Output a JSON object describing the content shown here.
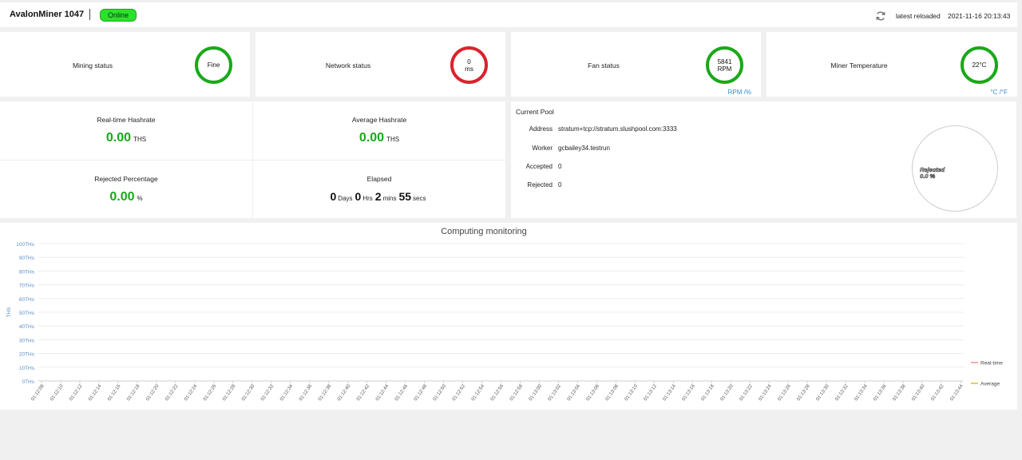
{
  "header": {
    "title": "AvalonMiner 1047",
    "status": "Online",
    "reload_label": "latest reloaded",
    "reload_time": "2021-11-16 20:13:43"
  },
  "status_cards": {
    "mining": {
      "label": "Mining status",
      "value": "Fine"
    },
    "network": {
      "label": "Network status",
      "value": "0",
      "unit": "ms"
    },
    "fan": {
      "label": "Fan status",
      "value": "5841",
      "unit": "RPM",
      "toggle": "RPM /%"
    },
    "temperature": {
      "label": "Miner Temperature",
      "value": "22°C",
      "toggle": "°C /°F"
    }
  },
  "hashrate": {
    "realtime": {
      "label": "Real-time Hashrate",
      "value": "0.00",
      "unit": "THS"
    },
    "average": {
      "label": "Average Hashrate",
      "value": "0.00",
      "unit": "THS"
    },
    "rejected": {
      "label": "Rejected Percentage",
      "value": "0.00",
      "unit": "%"
    },
    "elapsed": {
      "label": "Elapsed",
      "days": "0",
      "days_unit": "Days",
      "hrs": "0",
      "hrs_unit": "Hrs",
      "mins": "2",
      "mins_unit": "mins",
      "secs": "55",
      "secs_unit": "secs"
    }
  },
  "pool": {
    "title": "Current Pool",
    "rows": [
      {
        "key": "Address",
        "value": "stratum+tcp://stratum.slushpool.com:3333"
      },
      {
        "key": "Worker",
        "value": "gcbailey34.testrun"
      },
      {
        "key": "Accepted",
        "value": "0"
      },
      {
        "key": "Rejected",
        "value": "0"
      }
    ],
    "pie_label_1": "Rejected",
    "pie_label_2": "0.0 %"
  },
  "colors": {
    "good": "#1aa81a",
    "bad": "#d9232d",
    "link": "#3a8ad6",
    "realtime_line": "#e87a7a",
    "average_line": "#c9b400"
  },
  "chart_data": {
    "type": "line",
    "title": "Computing monitoring",
    "ylabel": "THS",
    "ylim": [
      0,
      100
    ],
    "y_ticks": [
      "0THs",
      "10THs",
      "20THs",
      "30THs",
      "40THs",
      "50THs",
      "60THs",
      "70THs",
      "80THs",
      "90THs",
      "100THs"
    ],
    "x": [
      "01:12:08",
      "01:12:10",
      "01:12:12",
      "01:12:14",
      "01:12:16",
      "01:12:18",
      "01:12:20",
      "01:12:22",
      "01:12:24",
      "01:12:26",
      "01:12:28",
      "01:12:30",
      "01:12:32",
      "01:12:34",
      "01:12:36",
      "01:12:38",
      "01:12:40",
      "01:12:42",
      "01:12:44",
      "01:12:46",
      "01:12:48",
      "01:12:50",
      "01:12:52",
      "01:12:54",
      "01:12:56",
      "01:12:58",
      "01:13:00",
      "01:13:02",
      "01:13:04",
      "01:13:06",
      "01:13:08",
      "01:13:10",
      "01:13:12",
      "01:13:14",
      "01:13:16",
      "01:13:18",
      "01:13:20",
      "01:13:22",
      "01:13:24",
      "01:13:26",
      "01:13:28",
      "01:13:30",
      "01:13:32",
      "01:13:34",
      "01:13:36",
      "01:13:38",
      "01:13:40",
      "01:13:42",
      "01:13:44"
    ],
    "series": [
      {
        "name": "Real-time",
        "values": []
      },
      {
        "name": "Average",
        "values": []
      }
    ],
    "grid": true,
    "legend": "right"
  }
}
